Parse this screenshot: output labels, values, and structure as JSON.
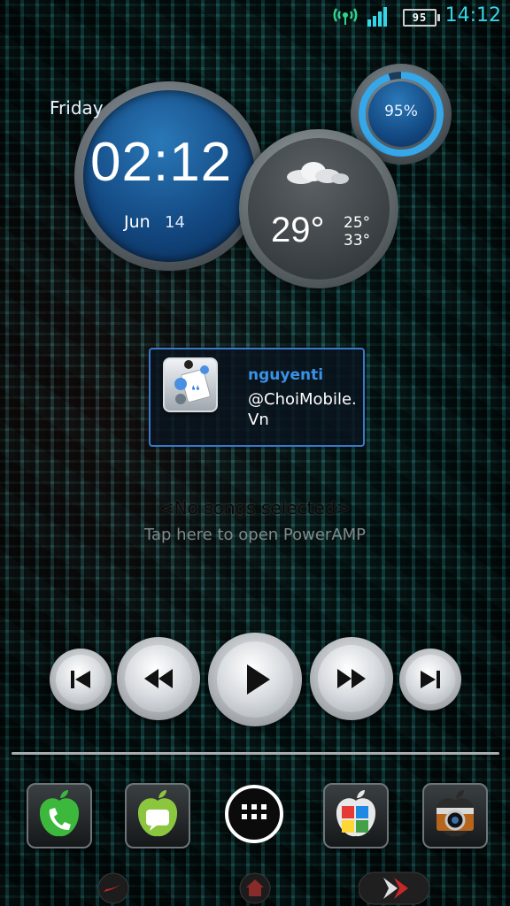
{
  "status_bar": {
    "time": "14:12",
    "battery_level": "95"
  },
  "clock_widget": {
    "day": "Friday",
    "time": "02:12",
    "month": "Jun",
    "date": "14"
  },
  "battery_widget": {
    "percent_label": "95%",
    "level": 0.95
  },
  "weather_widget": {
    "temperature": "29°",
    "high": "25°",
    "low": "33°",
    "condition_icon": "cloud-icon"
  },
  "twitter_widget": {
    "username": "nguyenti",
    "handle": "@ChoiMobile.Vn"
  },
  "music_widget": {
    "song_title": "<No songs selected>",
    "hint": "Tap here to open PowerAMP",
    "controls": [
      "skip-previous",
      "rewind",
      "play",
      "fast-forward",
      "skip-next"
    ]
  },
  "dock": {
    "apps": [
      "phone",
      "messages",
      "app-drawer",
      "gallery",
      "camera"
    ]
  },
  "colors": {
    "accent": "#35d5e8",
    "clock_blue": "#12467e",
    "twitter_blue": "#3a92e6"
  }
}
